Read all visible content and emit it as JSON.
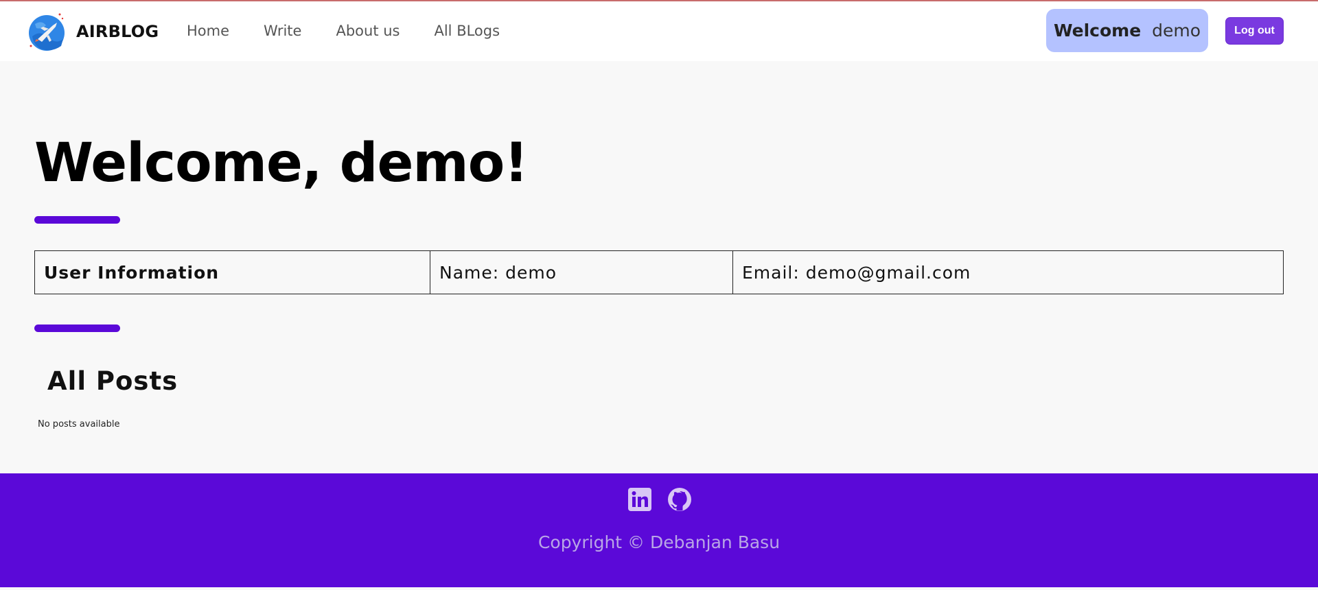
{
  "brand": {
    "name": "AIRBLOG",
    "logo_icon": "airplane-globe-icon"
  },
  "nav": {
    "links": [
      {
        "label": "Home"
      },
      {
        "label": "Write"
      },
      {
        "label": "About us"
      },
      {
        "label": "All BLogs"
      }
    ],
    "welcome_label": "Welcome",
    "username": "demo",
    "logout_label": "Log out"
  },
  "main": {
    "title": "Welcome, demo!",
    "user_info": {
      "heading": "User Information",
      "name": "Name: demo",
      "email": "Email: demo@gmail.com"
    },
    "posts_heading": "All Posts",
    "empty_message": "No posts available"
  },
  "footer": {
    "social_icons": [
      "linkedin-icon",
      "github-icon"
    ],
    "copyright": "Copyright © Debanjan Basu"
  },
  "colors": {
    "accent": "#5b09d8",
    "logout_button": "#7a3ae0",
    "welcome_pill": "#b4c2ff",
    "footer_bg": "#5b09d8",
    "footer_text": "#b9a6e6",
    "page_bg": "#f8f8f8"
  }
}
